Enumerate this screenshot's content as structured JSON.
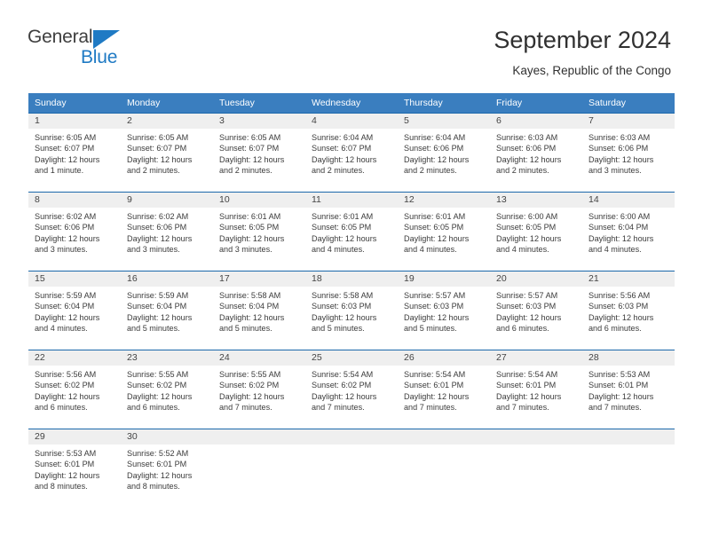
{
  "brand": {
    "name_part1": "General",
    "name_part2": "Blue",
    "triangle_icon": "triangle-icon",
    "accent_color": "#1f7ac4"
  },
  "header": {
    "title": "September 2024",
    "subtitle": "Kayes, Republic of the Congo"
  },
  "colors": {
    "header_row_bg": "#3a7ebf",
    "row_divider": "#1b68ab",
    "daynum_bg": "#efefef",
    "text": "#3b3b3b"
  },
  "weekdays": [
    "Sunday",
    "Monday",
    "Tuesday",
    "Wednesday",
    "Thursday",
    "Friday",
    "Saturday"
  ],
  "weeks": [
    [
      {
        "day": "1",
        "sunrise": "Sunrise: 6:05 AM",
        "sunset": "Sunset: 6:07 PM",
        "daylight_line1": "Daylight: 12 hours",
        "daylight_line2": "and 1 minute."
      },
      {
        "day": "2",
        "sunrise": "Sunrise: 6:05 AM",
        "sunset": "Sunset: 6:07 PM",
        "daylight_line1": "Daylight: 12 hours",
        "daylight_line2": "and 2 minutes."
      },
      {
        "day": "3",
        "sunrise": "Sunrise: 6:05 AM",
        "sunset": "Sunset: 6:07 PM",
        "daylight_line1": "Daylight: 12 hours",
        "daylight_line2": "and 2 minutes."
      },
      {
        "day": "4",
        "sunrise": "Sunrise: 6:04 AM",
        "sunset": "Sunset: 6:07 PM",
        "daylight_line1": "Daylight: 12 hours",
        "daylight_line2": "and 2 minutes."
      },
      {
        "day": "5",
        "sunrise": "Sunrise: 6:04 AM",
        "sunset": "Sunset: 6:06 PM",
        "daylight_line1": "Daylight: 12 hours",
        "daylight_line2": "and 2 minutes."
      },
      {
        "day": "6",
        "sunrise": "Sunrise: 6:03 AM",
        "sunset": "Sunset: 6:06 PM",
        "daylight_line1": "Daylight: 12 hours",
        "daylight_line2": "and 2 minutes."
      },
      {
        "day": "7",
        "sunrise": "Sunrise: 6:03 AM",
        "sunset": "Sunset: 6:06 PM",
        "daylight_line1": "Daylight: 12 hours",
        "daylight_line2": "and 3 minutes."
      }
    ],
    [
      {
        "day": "8",
        "sunrise": "Sunrise: 6:02 AM",
        "sunset": "Sunset: 6:06 PM",
        "daylight_line1": "Daylight: 12 hours",
        "daylight_line2": "and 3 minutes."
      },
      {
        "day": "9",
        "sunrise": "Sunrise: 6:02 AM",
        "sunset": "Sunset: 6:06 PM",
        "daylight_line1": "Daylight: 12 hours",
        "daylight_line2": "and 3 minutes."
      },
      {
        "day": "10",
        "sunrise": "Sunrise: 6:01 AM",
        "sunset": "Sunset: 6:05 PM",
        "daylight_line1": "Daylight: 12 hours",
        "daylight_line2": "and 3 minutes."
      },
      {
        "day": "11",
        "sunrise": "Sunrise: 6:01 AM",
        "sunset": "Sunset: 6:05 PM",
        "daylight_line1": "Daylight: 12 hours",
        "daylight_line2": "and 4 minutes."
      },
      {
        "day": "12",
        "sunrise": "Sunrise: 6:01 AM",
        "sunset": "Sunset: 6:05 PM",
        "daylight_line1": "Daylight: 12 hours",
        "daylight_line2": "and 4 minutes."
      },
      {
        "day": "13",
        "sunrise": "Sunrise: 6:00 AM",
        "sunset": "Sunset: 6:05 PM",
        "daylight_line1": "Daylight: 12 hours",
        "daylight_line2": "and 4 minutes."
      },
      {
        "day": "14",
        "sunrise": "Sunrise: 6:00 AM",
        "sunset": "Sunset: 6:04 PM",
        "daylight_line1": "Daylight: 12 hours",
        "daylight_line2": "and 4 minutes."
      }
    ],
    [
      {
        "day": "15",
        "sunrise": "Sunrise: 5:59 AM",
        "sunset": "Sunset: 6:04 PM",
        "daylight_line1": "Daylight: 12 hours",
        "daylight_line2": "and 4 minutes."
      },
      {
        "day": "16",
        "sunrise": "Sunrise: 5:59 AM",
        "sunset": "Sunset: 6:04 PM",
        "daylight_line1": "Daylight: 12 hours",
        "daylight_line2": "and 5 minutes."
      },
      {
        "day": "17",
        "sunrise": "Sunrise: 5:58 AM",
        "sunset": "Sunset: 6:04 PM",
        "daylight_line1": "Daylight: 12 hours",
        "daylight_line2": "and 5 minutes."
      },
      {
        "day": "18",
        "sunrise": "Sunrise: 5:58 AM",
        "sunset": "Sunset: 6:03 PM",
        "daylight_line1": "Daylight: 12 hours",
        "daylight_line2": "and 5 minutes."
      },
      {
        "day": "19",
        "sunrise": "Sunrise: 5:57 AM",
        "sunset": "Sunset: 6:03 PM",
        "daylight_line1": "Daylight: 12 hours",
        "daylight_line2": "and 5 minutes."
      },
      {
        "day": "20",
        "sunrise": "Sunrise: 5:57 AM",
        "sunset": "Sunset: 6:03 PM",
        "daylight_line1": "Daylight: 12 hours",
        "daylight_line2": "and 6 minutes."
      },
      {
        "day": "21",
        "sunrise": "Sunrise: 5:56 AM",
        "sunset": "Sunset: 6:03 PM",
        "daylight_line1": "Daylight: 12 hours",
        "daylight_line2": "and 6 minutes."
      }
    ],
    [
      {
        "day": "22",
        "sunrise": "Sunrise: 5:56 AM",
        "sunset": "Sunset: 6:02 PM",
        "daylight_line1": "Daylight: 12 hours",
        "daylight_line2": "and 6 minutes."
      },
      {
        "day": "23",
        "sunrise": "Sunrise: 5:55 AM",
        "sunset": "Sunset: 6:02 PM",
        "daylight_line1": "Daylight: 12 hours",
        "daylight_line2": "and 6 minutes."
      },
      {
        "day": "24",
        "sunrise": "Sunrise: 5:55 AM",
        "sunset": "Sunset: 6:02 PM",
        "daylight_line1": "Daylight: 12 hours",
        "daylight_line2": "and 7 minutes."
      },
      {
        "day": "25",
        "sunrise": "Sunrise: 5:54 AM",
        "sunset": "Sunset: 6:02 PM",
        "daylight_line1": "Daylight: 12 hours",
        "daylight_line2": "and 7 minutes."
      },
      {
        "day": "26",
        "sunrise": "Sunrise: 5:54 AM",
        "sunset": "Sunset: 6:01 PM",
        "daylight_line1": "Daylight: 12 hours",
        "daylight_line2": "and 7 minutes."
      },
      {
        "day": "27",
        "sunrise": "Sunrise: 5:54 AM",
        "sunset": "Sunset: 6:01 PM",
        "daylight_line1": "Daylight: 12 hours",
        "daylight_line2": "and 7 minutes."
      },
      {
        "day": "28",
        "sunrise": "Sunrise: 5:53 AM",
        "sunset": "Sunset: 6:01 PM",
        "daylight_line1": "Daylight: 12 hours",
        "daylight_line2": "and 7 minutes."
      }
    ],
    [
      {
        "day": "29",
        "sunrise": "Sunrise: 5:53 AM",
        "sunset": "Sunset: 6:01 PM",
        "daylight_line1": "Daylight: 12 hours",
        "daylight_line2": "and 8 minutes."
      },
      {
        "day": "30",
        "sunrise": "Sunrise: 5:52 AM",
        "sunset": "Sunset: 6:01 PM",
        "daylight_line1": "Daylight: 12 hours",
        "daylight_line2": "and 8 minutes."
      },
      {
        "day": "",
        "sunrise": "",
        "sunset": "",
        "daylight_line1": "",
        "daylight_line2": ""
      },
      {
        "day": "",
        "sunrise": "",
        "sunset": "",
        "daylight_line1": "",
        "daylight_line2": ""
      },
      {
        "day": "",
        "sunrise": "",
        "sunset": "",
        "daylight_line1": "",
        "daylight_line2": ""
      },
      {
        "day": "",
        "sunrise": "",
        "sunset": "",
        "daylight_line1": "",
        "daylight_line2": ""
      },
      {
        "day": "",
        "sunrise": "",
        "sunset": "",
        "daylight_line1": "",
        "daylight_line2": ""
      }
    ]
  ]
}
